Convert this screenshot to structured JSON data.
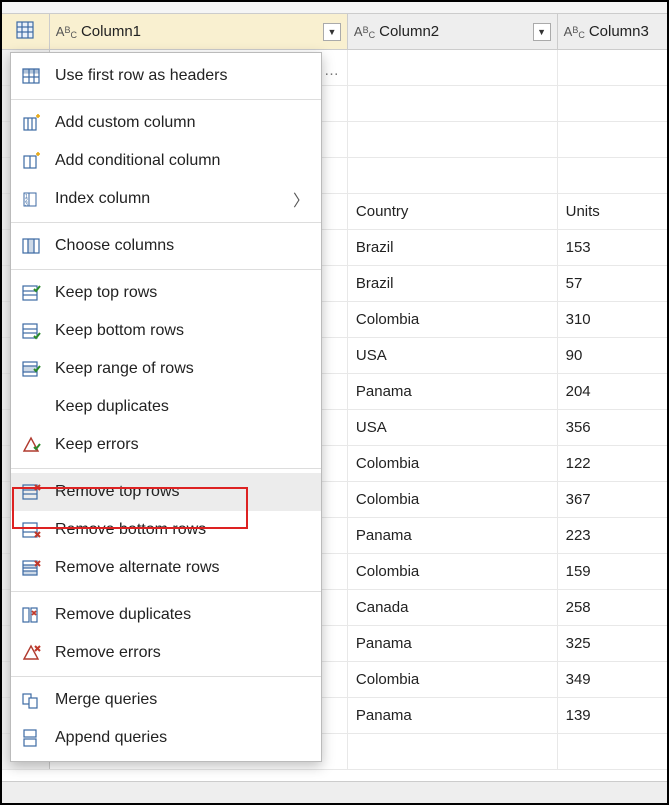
{
  "columns": {
    "col1": "Column1",
    "col2": "Column2",
    "col3": "Column3"
  },
  "menu": {
    "useFirstRow": "Use first row as headers",
    "addCustom": "Add custom column",
    "addConditional": "Add conditional column",
    "indexColumn": "Index column",
    "chooseColumns": "Choose columns",
    "keepTop": "Keep top rows",
    "keepBottom": "Keep bottom rows",
    "keepRange": "Keep range of rows",
    "keepDup": "Keep duplicates",
    "keepErrors": "Keep errors",
    "removeTop": "Remove top rows",
    "removeBottom": "Remove bottom rows",
    "removeAlt": "Remove alternate rows",
    "removeDup": "Remove duplicates",
    "removeErrors": "Remove errors",
    "mergeQ": "Merge queries",
    "appendQ": "Append queries"
  },
  "rows": [
    {
      "col2": "",
      "col3": ""
    },
    {
      "col2": "",
      "col3": ""
    },
    {
      "col2": "",
      "col3": ""
    },
    {
      "col2": "",
      "col3": ""
    },
    {
      "col2": "Country",
      "col3": "Units"
    },
    {
      "col2": "Brazil",
      "col3": "153"
    },
    {
      "col2": "Brazil",
      "col3": "57"
    },
    {
      "col2": "Colombia",
      "col3": "310"
    },
    {
      "col2": "USA",
      "col3": "90"
    },
    {
      "col2": "Panama",
      "col3": "204"
    },
    {
      "col2": "USA",
      "col3": "356"
    },
    {
      "col2": "Colombia",
      "col3": "122"
    },
    {
      "col2": "Colombia",
      "col3": "367"
    },
    {
      "col2": "Panama",
      "col3": "223"
    },
    {
      "col2": "Colombia",
      "col3": "159"
    },
    {
      "col2": "Canada",
      "col3": "258"
    },
    {
      "col2": "Panama",
      "col3": "325"
    },
    {
      "col2": "Colombia",
      "col3": "349"
    },
    {
      "col2": "Panama",
      "col3": "139"
    },
    {
      "col2": "",
      "col3": ""
    }
  ]
}
